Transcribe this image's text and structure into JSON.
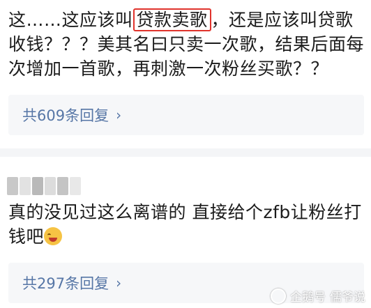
{
  "comments": [
    {
      "text_before": "这……这应该叫",
      "highlight": "贷款卖歌",
      "text_after": "，还是应该叫贷歌收钱？？？美其名曰只卖一次歌，结果后面每次增加一首歌，再刺激一次粉丝买歌？？",
      "reply_label": "共609条回复",
      "reply_chevron": "›"
    },
    {
      "text": "真的没见过这么离谱的 直接给个zfb让粉丝打钱吧",
      "emoji": "crying-emoji",
      "reply_label": "共297条回复",
      "reply_chevron": "›"
    }
  ],
  "watermark": {
    "source": "企鹅号",
    "author": "儒爷说"
  },
  "colors": {
    "highlight_border": "#e0332c",
    "reply_link": "#5676a6",
    "reply_bg": "#f6f7f9",
    "divider": "#f4f5f7"
  }
}
